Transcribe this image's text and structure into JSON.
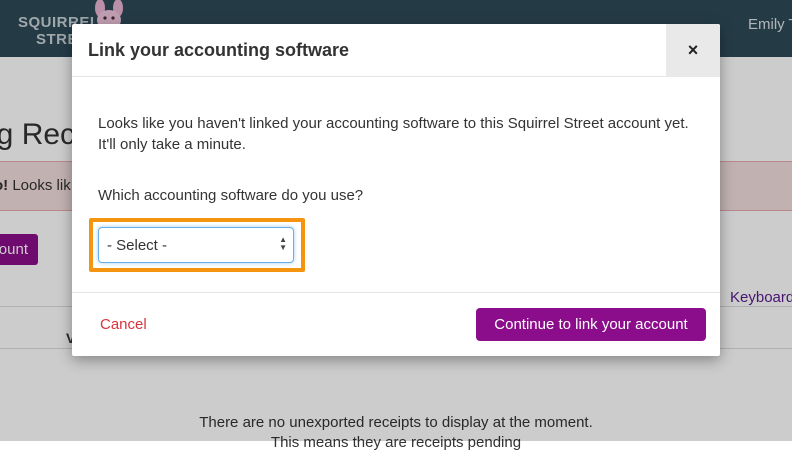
{
  "header": {
    "logo_line1": "SQUIRREL",
    "logo_line2": "STREET",
    "user_name": "Emily T"
  },
  "background": {
    "page_title": "ng Rec",
    "alert_bold": "o!",
    "alert_text": " Looks lik",
    "button_label": "ount",
    "keyboard_link": "Keyboard",
    "column_stub": "V",
    "empty_message": "There are no unexported receipts to display at the moment.",
    "empty_message_line2": "This means they are receipts pending"
  },
  "modal": {
    "title": "Link your accounting software",
    "close_label": "×",
    "body_text": "Looks like you haven't linked your accounting software to this Squirrel Street account yet. It'll only take a minute.",
    "question": "Which accounting software do you use?",
    "select": {
      "selected_value": "- Select -"
    },
    "cancel_label": "Cancel",
    "continue_label": "Continue to link your account"
  },
  "colors": {
    "topbar": "#2d4a58",
    "brand_purple": "#8b0d8b",
    "highlight_orange": "#f5950f",
    "cancel_red": "#d9343f"
  }
}
